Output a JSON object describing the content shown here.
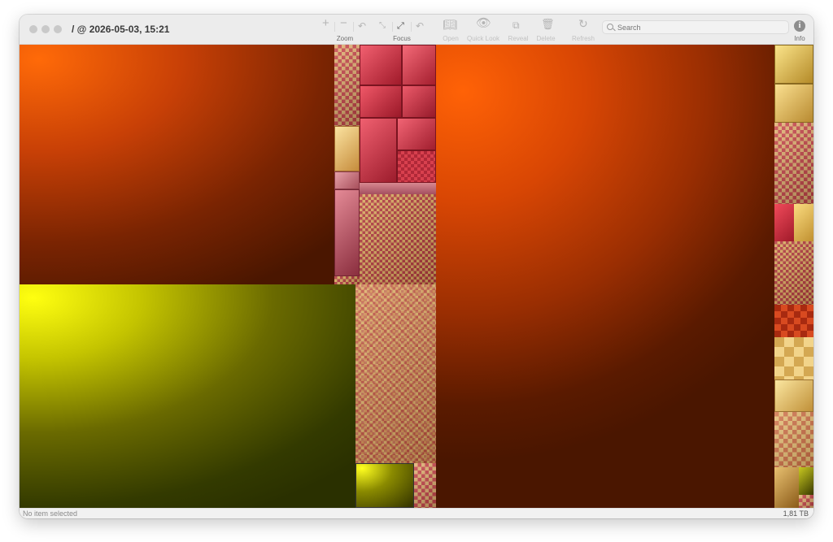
{
  "window": {
    "title": "/ @ 2026-05-03, 15:21"
  },
  "toolbar": {
    "zoom_label": "Zoom",
    "focus_label": "Focus",
    "open_label": "Open",
    "quicklook_label": "Quick Look",
    "reveal_label": "Reveal",
    "delete_label": "Delete",
    "refresh_label": "Refresh",
    "info_label": "Info",
    "search_placeholder": "Search"
  },
  "status": {
    "selection_text": "No item selected",
    "total_size": "1,81 TB"
  },
  "colors": {
    "orange": "#ff5a00",
    "dark_brown": "#4a1800",
    "yellow": "#ffff00",
    "olive": "#2e3300",
    "crimson": "#d8384a",
    "gold": "#e8c060"
  }
}
